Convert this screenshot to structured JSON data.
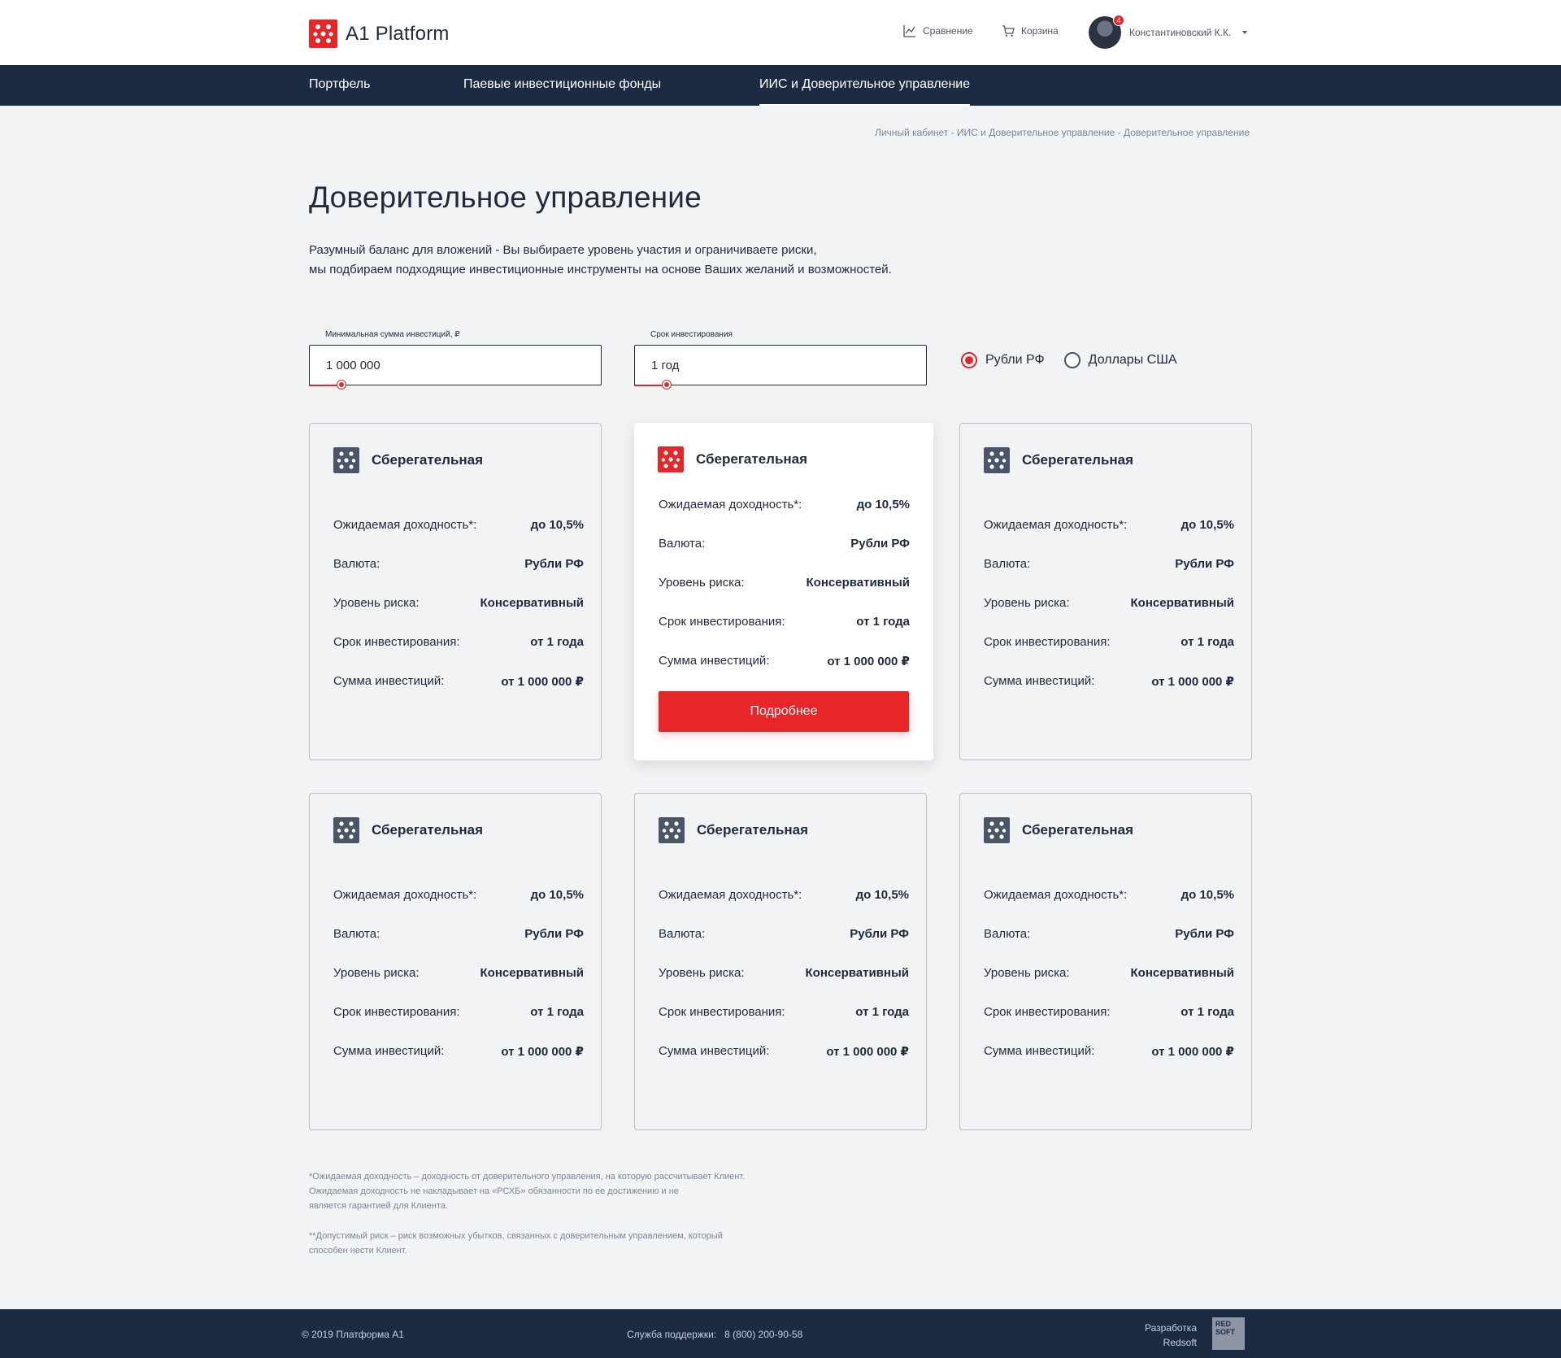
{
  "header": {
    "logo_text": "A1 Platform",
    "compare_label": "Сравнение",
    "cart_label": "Корзина",
    "user_name": "Константиновский К.К.",
    "notification_count": "4"
  },
  "nav": {
    "items": [
      {
        "label": "Портфель"
      },
      {
        "label": "Паевые инвестиционные фонды"
      },
      {
        "label": "ИИС и Доверительное управление"
      }
    ]
  },
  "breadcrumb": {
    "items": [
      "Личный кабинет",
      "ИИС и Доверительное управление",
      "Доверительное управление"
    ],
    "separator": " - "
  },
  "page": {
    "title": "Доверительное управление",
    "intro_line1": "Разумный баланс для вложений - Вы выбираете уровень участия и ограничиваете риски,",
    "intro_line2": "мы подбираем подходящие инвестиционные инструменты на основе Ваших желаний и возможностей."
  },
  "filters": {
    "amount": {
      "label": "Минимальная сумма инвестиций, ₽",
      "value": "1 000 000",
      "slider_fraction": 0.11
    },
    "term": {
      "label": "Срок инвестирования",
      "value": "1 год",
      "slider_fraction": 0.11
    },
    "currency": {
      "options": [
        "Рубли РФ",
        "Доллары США"
      ],
      "selected": "Рубли РФ"
    }
  },
  "cards": [
    {
      "title": "Сберегательная",
      "featured": false
    },
    {
      "title": "Сберегательная",
      "featured": true,
      "button": "Подробнее"
    },
    {
      "title": "Сберегательная",
      "featured": false
    },
    {
      "title": "Сберегательная",
      "featured": false
    },
    {
      "title": "Сберегательная",
      "featured": false
    },
    {
      "title": "Сберегательная",
      "featured": false
    }
  ],
  "card_rows": [
    {
      "key": "Ожидаемая доходность*:",
      "value": "до 10,5%"
    },
    {
      "key": "Валюта:",
      "value": "Рубли РФ"
    },
    {
      "key": "Уровень риска:",
      "value": "Консервативный"
    },
    {
      "key": "Срок инвестирования:",
      "value": "от 1 года"
    },
    {
      "key": "Сумма инвестиций:",
      "value": "от 1 000 000 ₽"
    }
  ],
  "footnotes": {
    "note1_l1": "*Ожидаемая доходность – доходность от доверительного управления, на которую рассчитывает Клиент.",
    "note1_l2": "Ожидаемая доходность не накладывает на «РСХБ» обязанности по ее достижению и не",
    "note1_l3": "является гарантией для Клиента.",
    "note2_l1": " **Допустимый риск – риск возможных убытков, связанных с доверительным управлением, который",
    "note2_l2": "способен нести Клиент."
  },
  "footer": {
    "copyright": "© 2019  Платформа А1",
    "support_label": "Служба поддержки:",
    "support_phone": "8 (800) 200-90-58",
    "dev_line1": "Разработка",
    "dev_line2": "Redsoft",
    "dev_logo_l1": "RED",
    "dev_logo_l2": "SOFT"
  },
  "colors": {
    "accent": "#e8262a",
    "nav_bg": "#1c2b44",
    "page_bg": "#f2f3f5",
    "icon_gray": "#4a5568"
  }
}
